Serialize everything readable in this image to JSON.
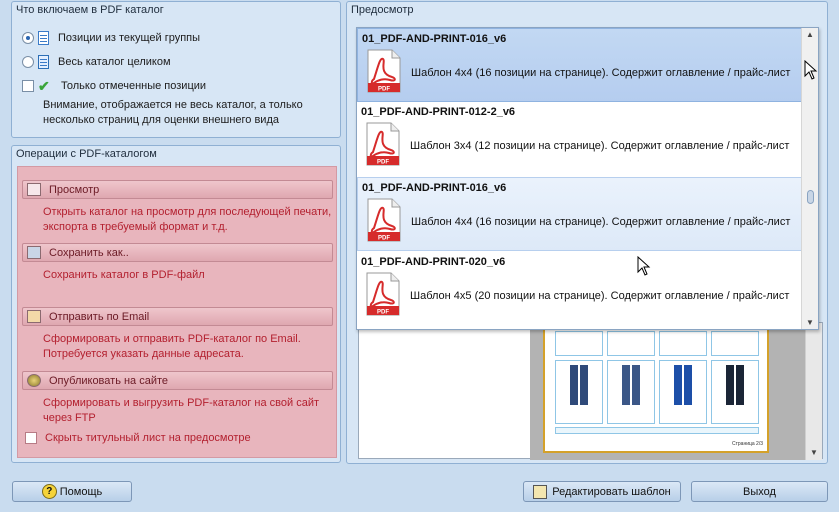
{
  "include_group": {
    "title": "Что включаем в PDF каталог",
    "options": [
      {
        "label": "Позиции из текущей группы",
        "selected": true
      },
      {
        "label": "Весь каталог целиком",
        "selected": false
      }
    ],
    "checkbox_label": "Только отмеченные позиции",
    "checkbox_checked": false,
    "note": "Внимание, отображается не весь каталог, а только несколько страниц для оценки внешнего вида"
  },
  "operations_group": {
    "title": "Операции с PDF-каталогом",
    "actions": [
      {
        "label": "Просмотр",
        "description": "Открыть каталог на просмотр для последующей печати, экспорта в требуемый формат и т.д.",
        "icon": "preview-icon"
      },
      {
        "label": "Сохранить как..",
        "description": "Сохранить каталог в PDF-файл",
        "icon": "floppy-disk-icon"
      },
      {
        "label": "Отправить по Email",
        "description": "Сформировать и отправить PDF-каталог по Email. Потребуется указать данные адресата.",
        "icon": "envelope-icon"
      },
      {
        "label": "Опубликовать на сайте",
        "description": "Сформировать и выгрузить PDF-каталог на свой сайт через FTP",
        "icon": "globe-icon"
      }
    ],
    "hide_title_label": "Скрыть титульный лист на предосмотре",
    "hide_title_checked": false
  },
  "preview_group": {
    "title": "Предосмотр",
    "selected": {
      "name": "01_PDF-AND-PRINT-016_v6",
      "description": "Шаблон 4x4 (16 позиции на странице). Содержит оглавление / прайс-лист"
    },
    "templates": [
      {
        "name": "01_PDF-AND-PRINT-012-2_v6",
        "description": "Шаблон 3x4 (12 позиции на странице). Содержит оглавление / прайс-лист"
      },
      {
        "name": "01_PDF-AND-PRINT-016_v6",
        "description": "Шаблон 4x4 (16 позиции на странице). Содержит оглавление / прайс-лист"
      },
      {
        "name": "01_PDF-AND-PRINT-020_v6",
        "description": "Шаблон 4x5 (20 позиции на странице). Содержит оглавление / прайс-лист"
      }
    ],
    "page_footer": "Страница 2/3"
  },
  "buttons": {
    "help": "Помощь",
    "edit_template": "Редактировать шаблон",
    "exit": "Выход"
  },
  "colors": {
    "window_bg": "#c9dcef",
    "operations_bg": "#e8b5bd",
    "selected_row": "#b5cdef",
    "operation_text": "#b3202f"
  }
}
